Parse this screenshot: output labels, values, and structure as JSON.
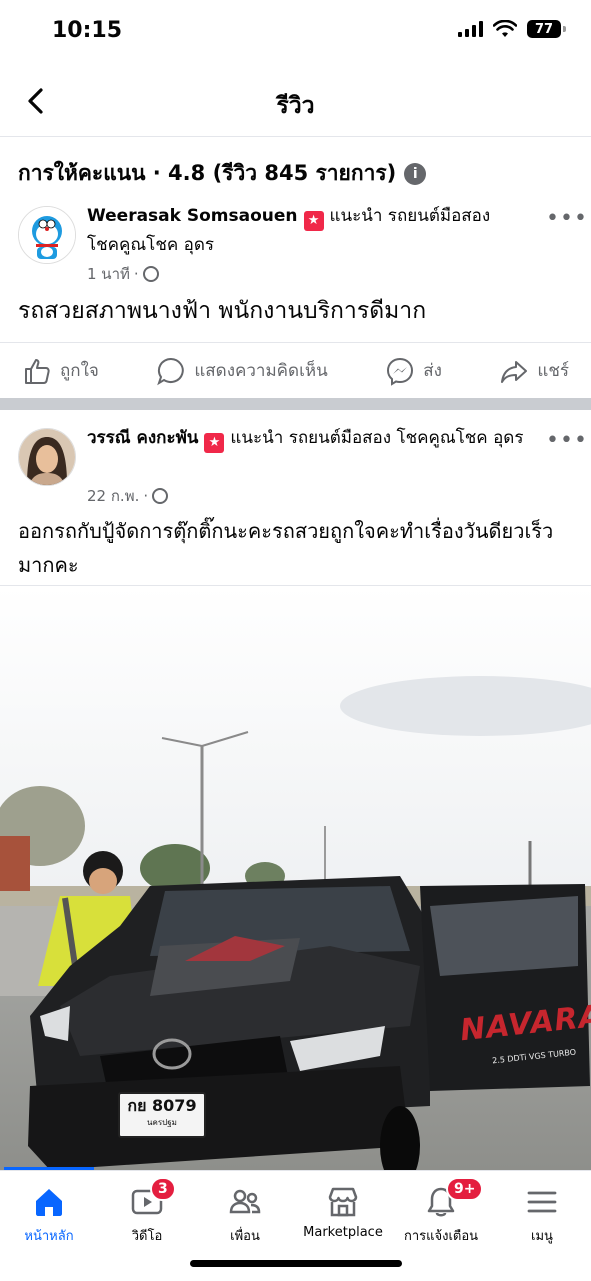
{
  "status": {
    "time": "10:15",
    "battery": "77"
  },
  "header": {
    "title": "รีวิว"
  },
  "rating": {
    "text": "การให้คะแนน · 4.8 (รีวิว 845 รายการ)"
  },
  "posts": [
    {
      "author": "Weerasak Somsaouen",
      "recommend": "แนะนำ รถยนต์มือสอง โชคคูณโชค อุดร",
      "time": "1 นาที",
      "text": "รถสวยสภาพนางฟ้า พนักงานบริการดีมาก"
    },
    {
      "author": "วรรณี คงกะพัน",
      "recommend": "แนะนำ รถยนต์มือสอง โชคคูณโชค อุดร",
      "time": "22 ก.พ.",
      "text": "ออกรถกับปู้จัดการตุ๊กติ๊กนะคะรถสวยถูกใจคะทำเรื่องวันดียวเร็วมากคะ"
    }
  ],
  "actions": {
    "like": "ถูกใจ",
    "comment": "แสดงความคิดเห็น",
    "send": "ส่ง",
    "share": "แชร์"
  },
  "photo": {
    "plate_line1": "กย 8079",
    "plate_line2": "นครปฐม",
    "brand_text": "NAVARA",
    "sub_text": "2.5 DDTi VGS TURBO"
  },
  "tabbar": {
    "items": [
      {
        "label": "หน้าหลัก",
        "icon": "home-icon"
      },
      {
        "label": "วิดีโอ",
        "icon": "video-icon",
        "badge": "3"
      },
      {
        "label": "เพื่อน",
        "icon": "friends-icon"
      },
      {
        "label": "Marketplace",
        "icon": "marketplace-icon"
      },
      {
        "label": "การแจ้งเตือน",
        "icon": "bell-icon",
        "badge": "9+"
      },
      {
        "label": "เมนู",
        "icon": "menu-icon"
      }
    ]
  },
  "colors": {
    "accent": "#0866ff",
    "badge": "#e41e3f",
    "secondary_text": "#65676b"
  }
}
